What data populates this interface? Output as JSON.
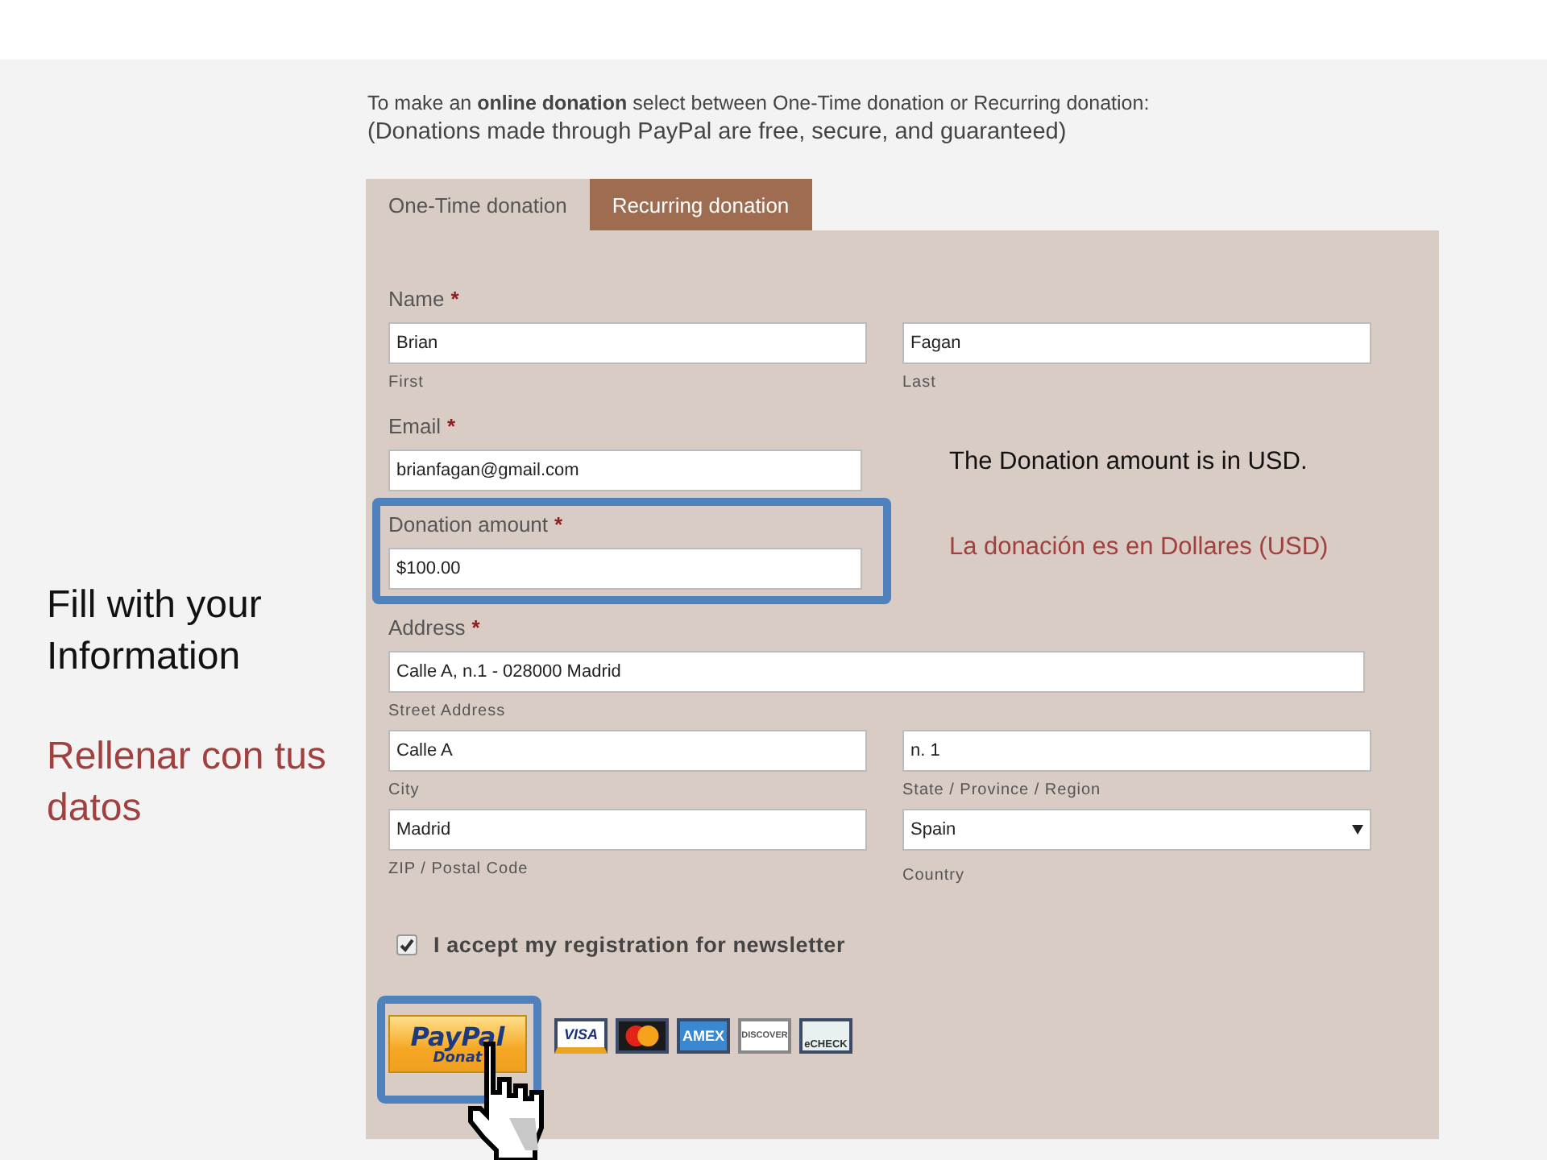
{
  "notes": [
    {
      "text": "Fill with your Information",
      "color": "#111111"
    },
    {
      "text": "Rellenar con tus datos",
      "color": "#a0403f"
    }
  ],
  "intro": {
    "text": "To make an **online donation** select between One-Time donation or Recurring donation:",
    "note": "(Donations made through PayPal are free, secure, and guaranteed)"
  },
  "tabs": [
    {
      "label": "One-Time donation",
      "selected": true
    },
    {
      "label": "Recurring donation",
      "selected": false
    }
  ],
  "form": {
    "name": {
      "label": "Name",
      "mark": "*",
      "first": "Brian",
      "first_caption": "First",
      "last": "Fagan",
      "last_caption": "Last"
    },
    "email": {
      "label": "Email",
      "mark": "*",
      "value": "brianfagan@gmail.com"
    },
    "amount": {
      "label": "Donation amount",
      "mark": "*",
      "value": "$100.00",
      "highlighted": true
    },
    "side_notes": [
      {
        "text": "The Donation amount is in USD.",
        "color": "#111111"
      },
      {
        "text": "La donación es en Dollares (USD)",
        "color": "#a0403f"
      }
    ],
    "address": {
      "label": "Address",
      "mark": "*",
      "street": "Calle A, n.1 - 028000 Madrid",
      "street_caption": "Street Address",
      "city": "Calle A",
      "city_caption": "City",
      "state": "n. 1",
      "state_caption": "State / Province / Region",
      "zip": "Madrid",
      "zip_caption": "ZIP / Postal Code",
      "country": "Spain",
      "country_caption": "Country"
    },
    "newsletter": {
      "label": "I accept my registration for newsletter",
      "checked": true
    },
    "paypal": {
      "brand": "PayPal",
      "action": "Donat",
      "highlighted": true
    },
    "cards": [
      {
        "kind": "visa",
        "label": "VISA"
      },
      {
        "kind": "mastercard"
      },
      {
        "kind": "amex",
        "label": "AMEX"
      },
      {
        "kind": "discover",
        "label": "DISCOVER"
      },
      {
        "kind": "echeck",
        "label": "eCHECK"
      }
    ]
  }
}
